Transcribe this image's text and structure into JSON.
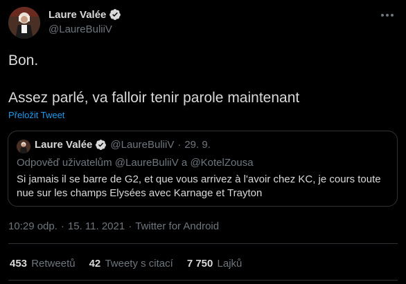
{
  "author": {
    "display_name": "Laure Valée",
    "handle": "@LaureBuliiV"
  },
  "tweet": {
    "text": "Bon.\n\nAssez parlé, va falloir tenir parole maintenant",
    "translate_label": "Přeložit Tweet"
  },
  "quoted": {
    "display_name": "Laure Valée",
    "handle": "@LaureBuliiV",
    "dot": "·",
    "date": "29. 9.",
    "reply_prefix": "Odpověď uživatelům",
    "reply_user1": "@LaureBuliiV",
    "reply_joiner": "a",
    "reply_user2": "@KotelZousa",
    "text": "Si jamais il se barre de G2, et que vous arrivez à l'avoir chez KC, je cours toute nue sur les champs Elysées avec Karnage et Trayton"
  },
  "meta": {
    "time": "10:29 odp.",
    "date": "15. 11. 2021",
    "source": "Twitter for Android",
    "sep": "·"
  },
  "stats": {
    "retweets_count": "453",
    "retweets_label": "Retweetů",
    "quotes_count": "42",
    "quotes_label": "Tweety s citací",
    "likes_count": "7 750",
    "likes_label": "Lajků"
  },
  "icons": {
    "verified": "verified-badge-icon",
    "more": "more-horizontal-icon"
  },
  "colors": {
    "background": "#000000",
    "text": "#d9d9d9",
    "secondary": "#6e767d",
    "accent": "#1d9bf0",
    "border": "#2f3336"
  }
}
